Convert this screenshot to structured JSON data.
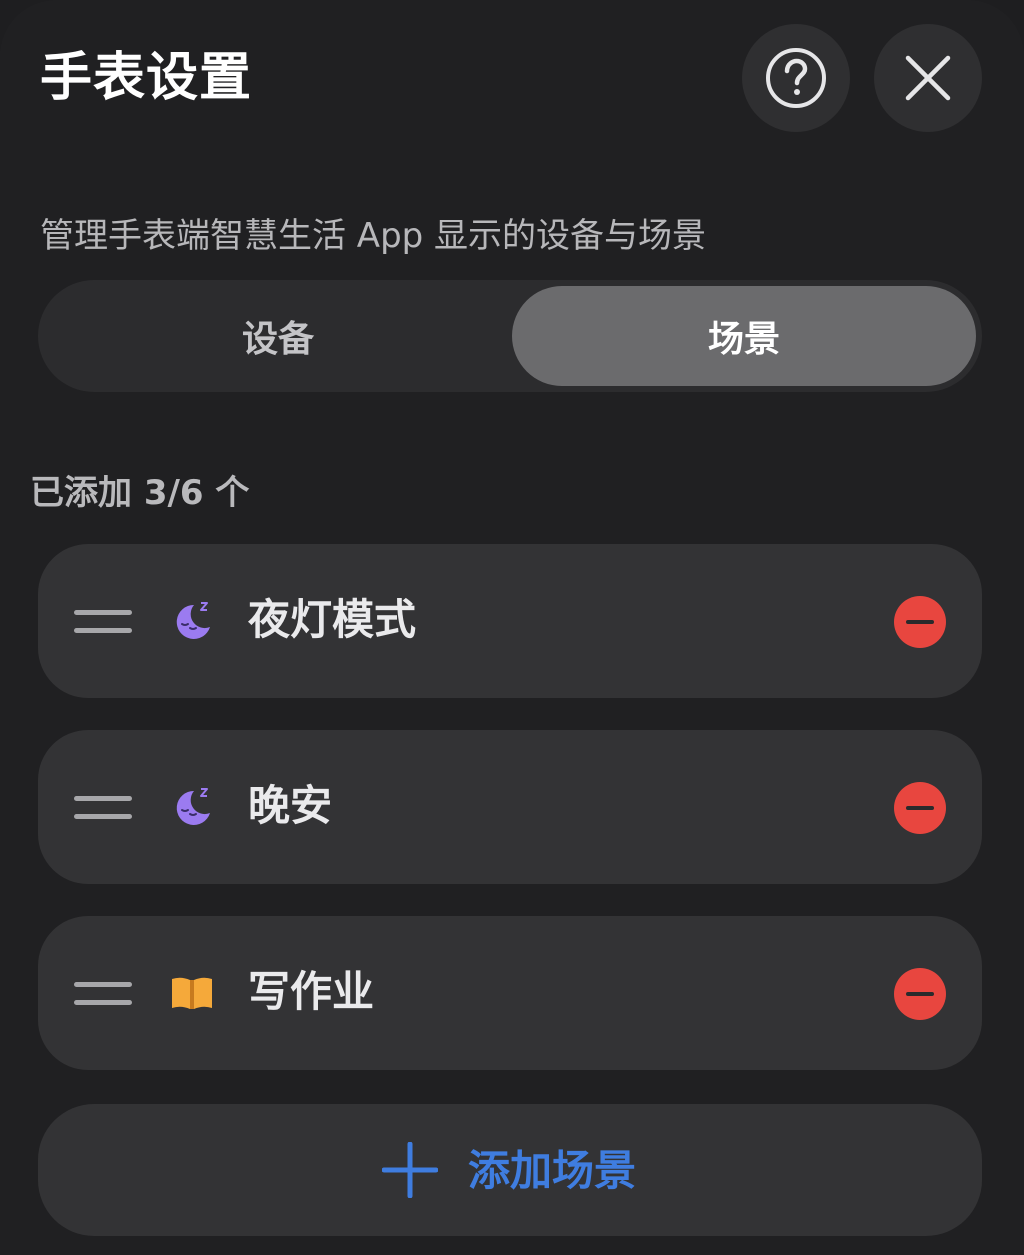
{
  "header": {
    "title": "手表设置",
    "help_icon": "help-circle-icon",
    "close_icon": "close-icon"
  },
  "subtitle": "管理手表端智慧生活 App 显示的设备与场景",
  "tabs": [
    {
      "label": "设备",
      "selected": false
    },
    {
      "label": "场景",
      "selected": true
    }
  ],
  "count_label": "已添加 3/6 个",
  "scenes": [
    {
      "label": "夜灯模式",
      "icon": "moon-sleep-icon"
    },
    {
      "label": "晚安",
      "icon": "moon-sleep-icon"
    },
    {
      "label": "写作业",
      "icon": "open-book-icon"
    }
  ],
  "add_button": {
    "label": "添加场景",
    "icon": "plus-icon"
  },
  "colors": {
    "background": "#202022",
    "card": "#333335",
    "selected_tab": "#6b6b6d",
    "remove": "#e8463f",
    "accent_blue": "#3f7de0",
    "moon_purple": "#9b7bf0",
    "book_orange": "#f5a93a"
  }
}
